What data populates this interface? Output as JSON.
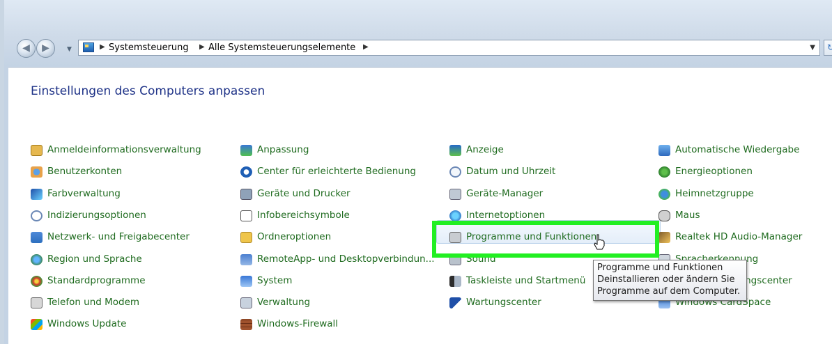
{
  "breadcrumb": [
    "Systemsteuerung",
    "Alle Systemsteuerungselemente"
  ],
  "heading": "Einstellungen des Computers anpassen",
  "columns": [
    [
      {
        "label": "Anmeldeinformationsverwaltung",
        "icon": "credential-vault-icon"
      },
      {
        "label": "Benutzerkonten",
        "icon": "user-accounts-icon"
      },
      {
        "label": "Farbverwaltung",
        "icon": "color-management-icon"
      },
      {
        "label": "Indizierungsoptionen",
        "icon": "indexing-icon"
      },
      {
        "label": "Netzwerk- und Freigabecenter",
        "icon": "network-icon"
      },
      {
        "label": "Region und Sprache",
        "icon": "globe-icon"
      },
      {
        "label": "Standardprogramme",
        "icon": "default-programs-icon"
      },
      {
        "label": "Telefon und Modem",
        "icon": "phone-modem-icon"
      },
      {
        "label": "Windows Update",
        "icon": "windows-update-icon"
      }
    ],
    [
      {
        "label": "Anpassung",
        "icon": "personalization-icon"
      },
      {
        "label": "Center für erleichterte Bedienung",
        "icon": "ease-of-access-icon"
      },
      {
        "label": "Geräte und Drucker",
        "icon": "printer-icon"
      },
      {
        "label": "Infobereichsymbole",
        "icon": "notification-area-icon"
      },
      {
        "label": "Ordneroptionen",
        "icon": "folder-options-icon"
      },
      {
        "label": "RemoteApp- und Desktopverbindun...",
        "icon": "remoteapp-icon"
      },
      {
        "label": "System",
        "icon": "system-icon"
      },
      {
        "label": "Verwaltung",
        "icon": "admin-tools-icon"
      },
      {
        "label": "Windows-Firewall",
        "icon": "firewall-icon"
      }
    ],
    [
      {
        "label": "Anzeige",
        "icon": "display-icon"
      },
      {
        "label": "Datum und Uhrzeit",
        "icon": "clock-icon"
      },
      {
        "label": "Geräte-Manager",
        "icon": "device-manager-icon"
      },
      {
        "label": "Internetoptionen",
        "icon": "internet-options-icon"
      },
      {
        "label": "Programme und Funktionen",
        "icon": "programs-icon"
      },
      {
        "label": "Sound",
        "icon": "sound-icon"
      },
      {
        "label": "Taskleiste und Startmenü",
        "icon": "taskbar-icon"
      },
      {
        "label": "Wartungscenter",
        "icon": "action-center-flag-icon"
      }
    ],
    [
      {
        "label": "Automatische Wiedergabe",
        "icon": "autoplay-icon"
      },
      {
        "label": "Energieoptionen",
        "icon": "power-options-icon"
      },
      {
        "label": "Heimnetzgruppe",
        "icon": "homegroup-icon"
      },
      {
        "label": "Maus",
        "icon": "mouse-icon"
      },
      {
        "label": "Realtek HD Audio-Manager",
        "icon": "realtek-audio-icon"
      },
      {
        "label": "Spracherkennung",
        "icon": "speech-icon"
      },
      {
        "label": "Synchronisierungscenter",
        "icon": "sync-icon"
      },
      {
        "label": "Windows CardSpace",
        "icon": "cardspace-icon"
      }
    ]
  ],
  "tooltip": {
    "title": "Programme und Funktionen",
    "line1": "Deinstallieren oder ändern Sie",
    "line2": "Programme auf dem Computer."
  },
  "colors": {
    "link": "#1f6b1f",
    "heading": "#1e3287",
    "highlight": "#22ef22"
  }
}
